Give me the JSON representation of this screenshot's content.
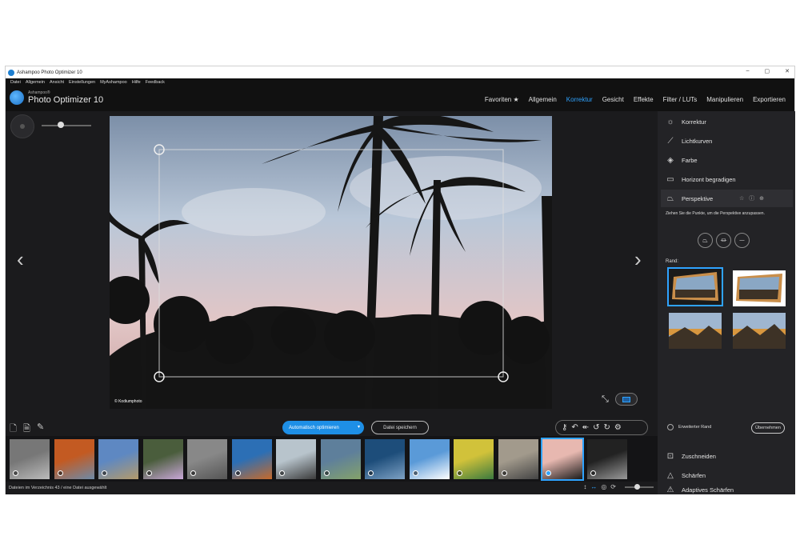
{
  "window": {
    "title": "Ashampoo Photo Optimizer 10",
    "controls": [
      "–",
      "▢",
      "✕"
    ]
  },
  "menu": [
    "Datei",
    "Allgemein",
    "Ansicht",
    "Einstellungen",
    "MyAshampoo",
    "Hilfe",
    "Feedback"
  ],
  "brand": {
    "small": "Ashampoo®",
    "big": "Photo Optimizer 10"
  },
  "tabs": [
    {
      "label": "Favoriten ★",
      "active": false
    },
    {
      "label": "Allgemein",
      "active": false
    },
    {
      "label": "Korrektur",
      "active": true
    },
    {
      "label": "Gesicht",
      "active": false
    },
    {
      "label": "Effekte",
      "active": false
    },
    {
      "label": "Filter / LUTs",
      "active": false
    },
    {
      "label": "Manipulieren",
      "active": false
    },
    {
      "label": "Exportieren",
      "active": false
    }
  ],
  "photo": {
    "credit": "© Kodiumphoto"
  },
  "nav": {
    "prev": "‹",
    "next": "›"
  },
  "buttons": {
    "auto_optimize": "Automatisch optimieren",
    "auto_caret": "▾",
    "save_file": "Datei speichern"
  },
  "status": {
    "text": "Dateien im Verzeichnis 43 / eine Datei ausgewählt"
  },
  "panel": {
    "tools_top": [
      {
        "label": "Korrektur",
        "icon": "☼"
      },
      {
        "label": "Lichtkurven",
        "icon": "⟋"
      },
      {
        "label": "Farbe",
        "icon": "◈"
      },
      {
        "label": "Horizont begradigen",
        "icon": "▭"
      },
      {
        "label": "Perspektive",
        "icon": "⏢",
        "active": true
      }
    ],
    "perspective_stars": "☆ ⓘ ⊕",
    "perspective_hint": "Ziehen Sie die Punkte, um die Perspektive anzupassen.",
    "perspective_modes": [
      "⏢",
      "⏛",
      "⏤"
    ],
    "rand_label": "Rand:",
    "extended_label": "Erweiterter Rand",
    "apply_label": "Übernehmen",
    "tools_bottom": [
      {
        "label": "Zuschneiden",
        "icon": "⊡"
      },
      {
        "label": "Schärfen",
        "icon": "△"
      },
      {
        "label": "Adaptives Schärfen",
        "icon": "⚠"
      }
    ]
  },
  "thumbnails": [
    {
      "name": "route-66",
      "colors": [
        "#777",
        "#bbb"
      ]
    },
    {
      "name": "canyon-bend",
      "colors": [
        "#c35a22",
        "#6d8aa8"
      ]
    },
    {
      "name": "cliffs",
      "colors": [
        "#5e88c2",
        "#b49a6a"
      ]
    },
    {
      "name": "flowers",
      "colors": [
        "#4a5d3c",
        "#c9a7d8"
      ]
    },
    {
      "name": "rocks",
      "colors": [
        "#888",
        "#555"
      ]
    },
    {
      "name": "monument-valley",
      "colors": [
        "#2c6fb5",
        "#c76a2a"
      ]
    },
    {
      "name": "street",
      "colors": [
        "#b8c4cc",
        "#3b3b3b"
      ]
    },
    {
      "name": "coast",
      "colors": [
        "#5e7f9b",
        "#84a26a"
      ]
    },
    {
      "name": "fjord",
      "colors": [
        "#1d4d7a",
        "#7da1c4"
      ]
    },
    {
      "name": "santorini",
      "colors": [
        "#5a9ad8",
        "#ffffff"
      ]
    },
    {
      "name": "bus",
      "colors": [
        "#d1c23a",
        "#3b7a3f"
      ]
    },
    {
      "name": "building",
      "colors": [
        "#a29a8c",
        "#444"
      ]
    },
    {
      "name": "palms",
      "colors": [
        "#e7b8b0",
        "#1a1a1a"
      ]
    },
    {
      "name": "bw-room",
      "colors": [
        "#222",
        "#999"
      ]
    }
  ]
}
